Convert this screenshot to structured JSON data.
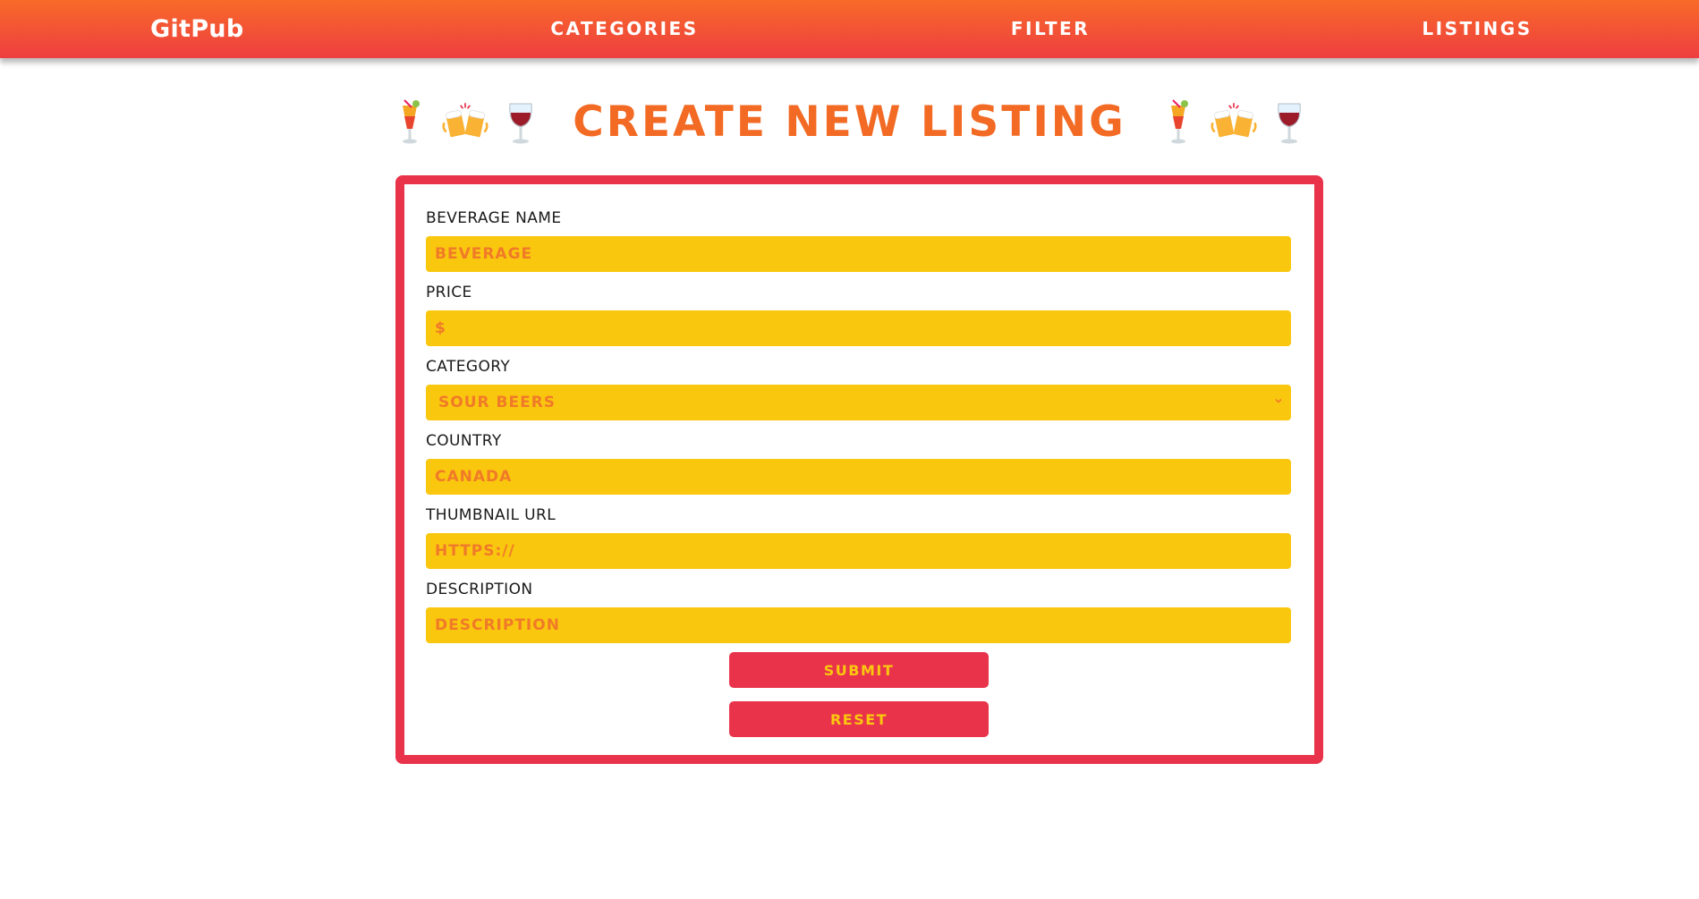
{
  "nav": {
    "brand": "GitPub",
    "links": [
      "CATEGORIES",
      "FILTER",
      "LISTINGS"
    ]
  },
  "page": {
    "title": "CREATE NEW LISTING",
    "title_color": "#f26a23",
    "emoji_icons": [
      "tropical-drink-icon",
      "clinking-beer-mugs-icon",
      "wine-glass-icon"
    ]
  },
  "form": {
    "fields": [
      {
        "label": "BEVERAGE NAME",
        "placeholder": "BEVERAGE"
      },
      {
        "label": "PRICE",
        "placeholder": "$"
      },
      {
        "label": "CATEGORY",
        "value": "SOUR BEERS"
      },
      {
        "label": "COUNTRY",
        "placeholder": "CANADA"
      },
      {
        "label": "THUMBNAIL URL",
        "placeholder": "HTTPS://"
      },
      {
        "label": "DESCRIPTION",
        "placeholder": "DESCRIPTION"
      }
    ],
    "submit_label": "SUBMIT",
    "reset_label": "RESET"
  },
  "colors": {
    "accent": "#e8334a",
    "input_bg": "#fac70f",
    "input_text": "#f07a28",
    "nav_gradient_top": "#f86a29",
    "nav_gradient_bottom": "#ee3e40"
  }
}
